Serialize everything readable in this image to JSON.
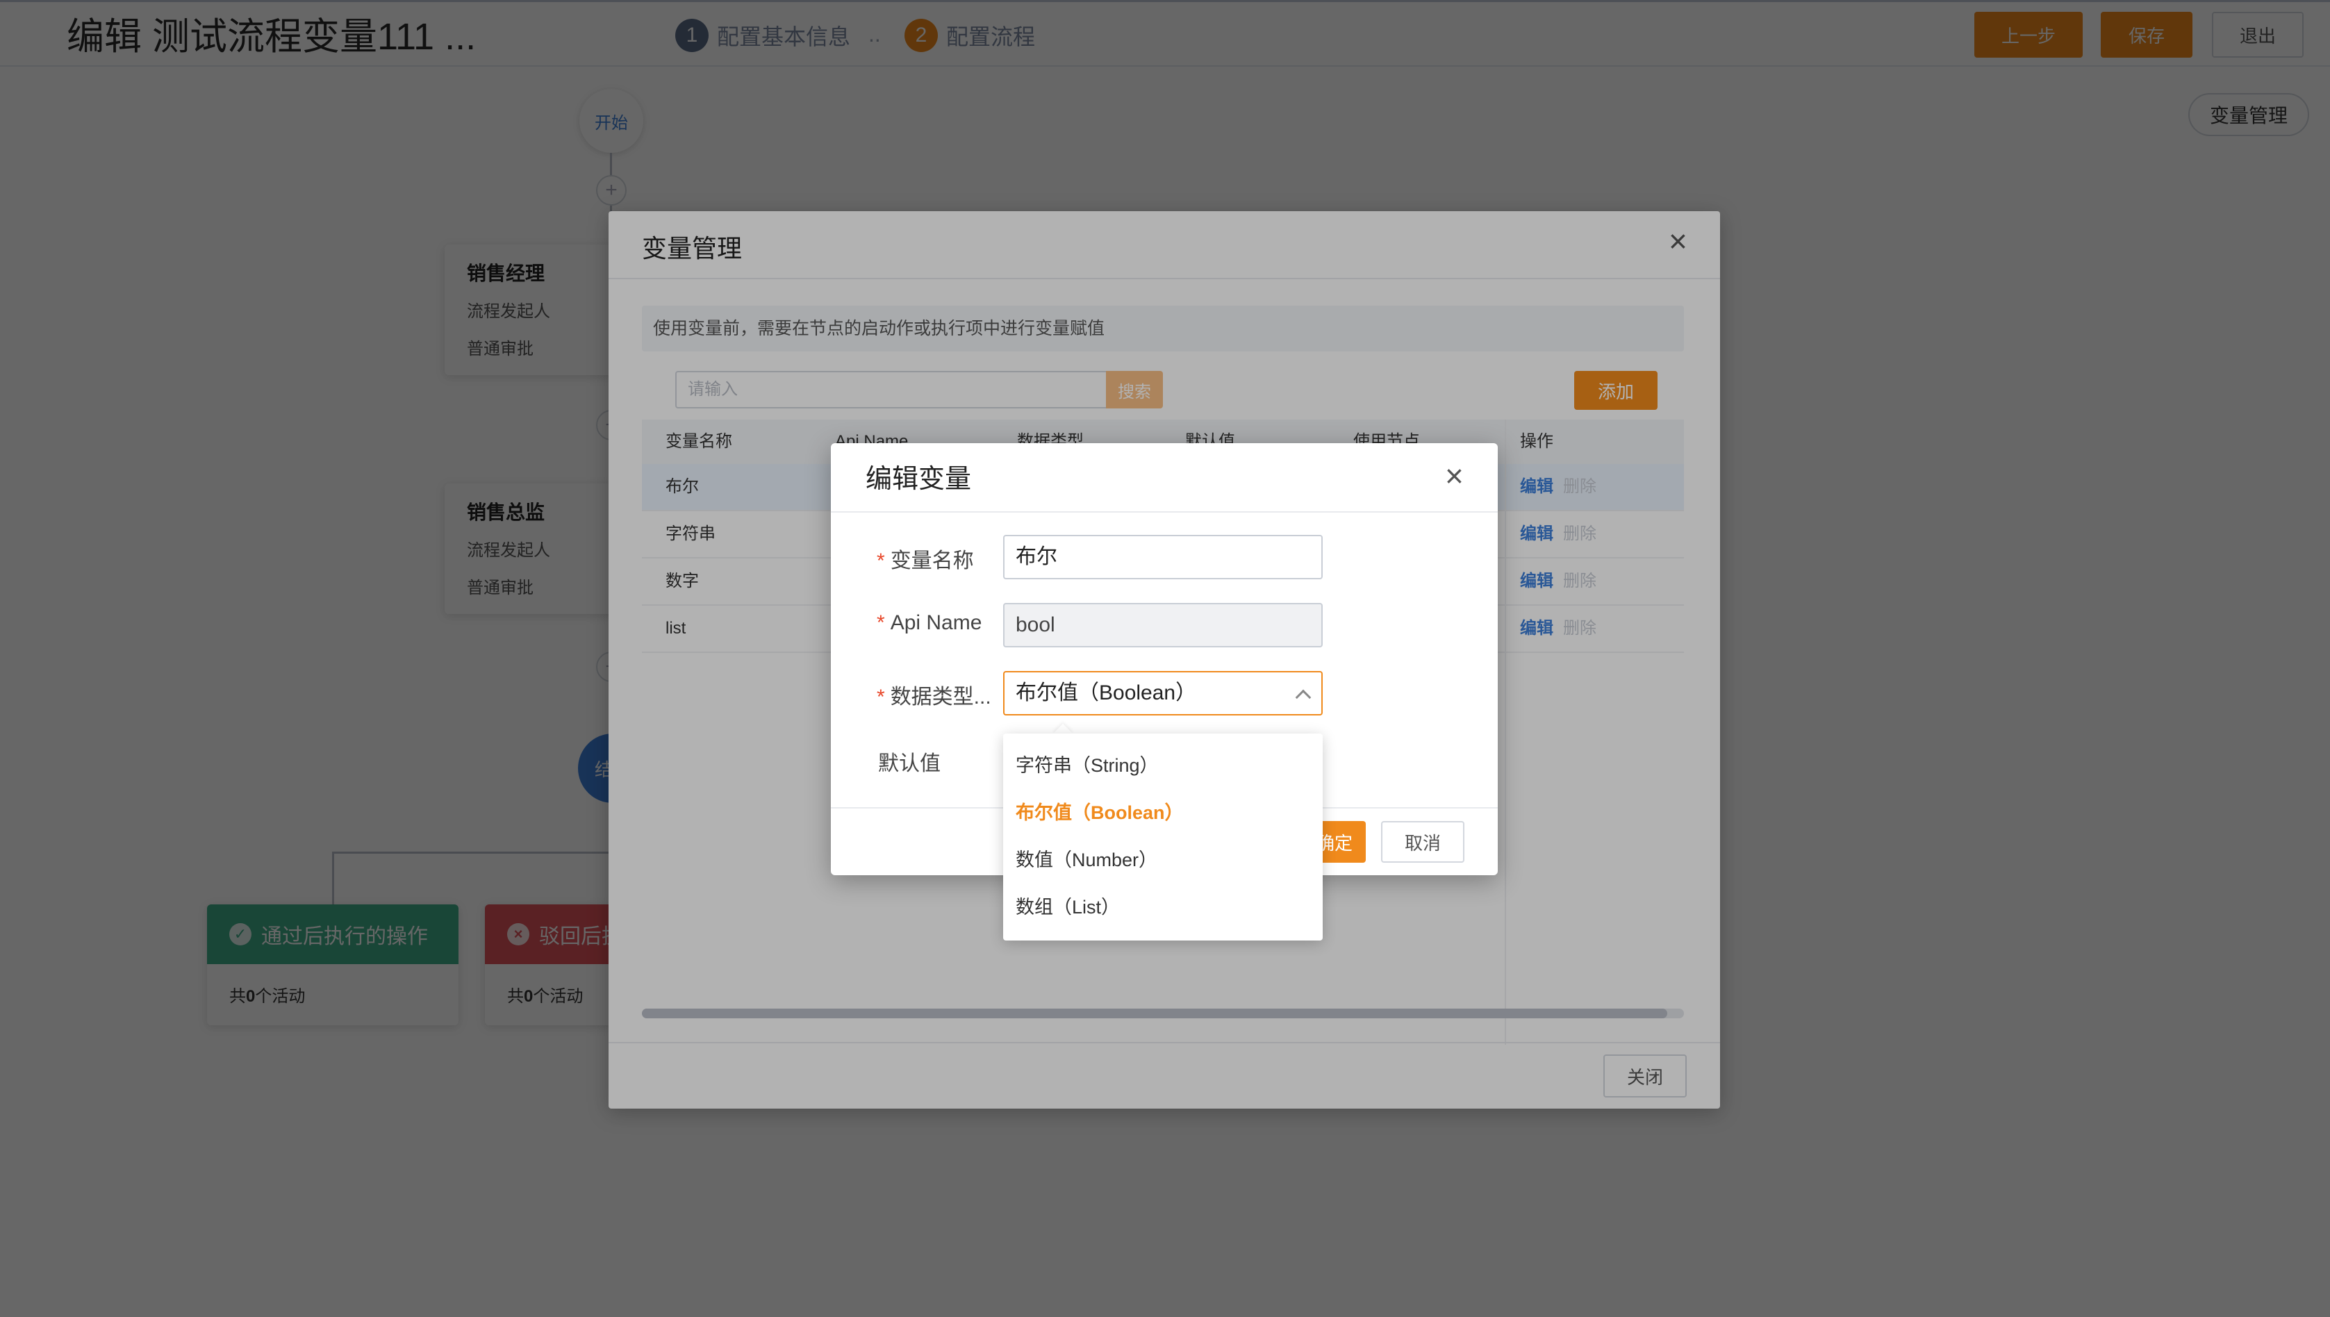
{
  "header": {
    "title": "编辑 测试流程变量111 ...",
    "steps": [
      {
        "num": "1",
        "label": "配置基本信息"
      },
      {
        "num": "2",
        "label": "配置流程"
      }
    ],
    "step_dots": "..",
    "prev_label": "上一步",
    "save_label": "保存",
    "exit_label": "退出"
  },
  "canvas": {
    "start_label": "开始",
    "end_label": "结",
    "var_manage_label": "变量管理",
    "nodes": [
      {
        "title": "销售经理",
        "sub1": "流程发起人",
        "sub2": "普通审批"
      },
      {
        "title": "销售总监",
        "sub1": "流程发起人",
        "sub2": "普通审批"
      }
    ],
    "branches": [
      {
        "title": "通过后执行的操作",
        "count_prefix": "共",
        "count": "0",
        "count_suffix": "个活动"
      },
      {
        "title": "驳回后执",
        "count_prefix": "共",
        "count": "0",
        "count_suffix": "个活动"
      }
    ]
  },
  "var_dialog": {
    "title": "变量管理",
    "notice": "使用变量前，需要在节点的启动作或执行项中进行变量赋值",
    "search_placeholder": "请输入",
    "search_label": "搜索",
    "add_label": "添加",
    "columns": [
      "变量名称",
      "Api Name",
      "数据类型",
      "默认值",
      "使用节点",
      "操作"
    ],
    "rows": [
      {
        "name": "布尔"
      },
      {
        "name": "字符串"
      },
      {
        "name": "数字"
      },
      {
        "name": "list"
      }
    ],
    "edit_label": "编辑",
    "delete_label": "删除",
    "close_label": "关闭"
  },
  "edit_dialog": {
    "title": "编辑变量",
    "name_label": "变量名称",
    "name_value": "布尔",
    "api_label": "Api Name",
    "api_value": "bool",
    "type_label": "数据类型...",
    "type_value": "布尔值（Boolean）",
    "default_label": "默认值",
    "ok_label": "确定",
    "cancel_label": "取消",
    "options": [
      {
        "label": "字符串（String）",
        "active": false
      },
      {
        "label": "布尔值（Boolean）",
        "active": true
      },
      {
        "label": "数值（Number）",
        "active": false
      },
      {
        "label": "数组（List）",
        "active": false
      }
    ]
  },
  "colors": {
    "accent": "#f08a1c",
    "link": "#3d7fd8",
    "success": "#3fae8a",
    "danger": "#e0535a"
  }
}
